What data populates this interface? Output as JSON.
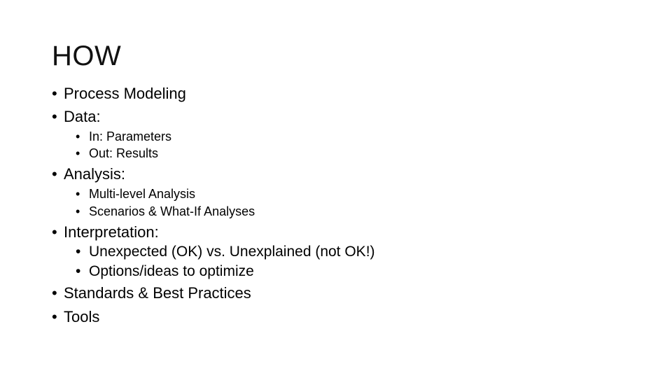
{
  "slide": {
    "title": "HOW",
    "bullet_glyph": "•",
    "items": [
      {
        "text": "Process Modeling"
      },
      {
        "text": "Data:",
        "children": [
          {
            "text": "In: Parameters"
          },
          {
            "text": "Out: Results"
          }
        ]
      },
      {
        "text": "Analysis:",
        "children": [
          {
            "text": "Multi-level Analysis"
          },
          {
            "text": "Scenarios & What-If Analyses"
          }
        ]
      },
      {
        "text": "Interpretation:",
        "children": [
          {
            "text": "Unexpected (OK) vs. Unexplained (not OK!)"
          },
          {
            "text": "Options/ideas to optimize"
          }
        ]
      },
      {
        "text": "Standards & Best Practices"
      },
      {
        "text": "Tools"
      }
    ]
  }
}
